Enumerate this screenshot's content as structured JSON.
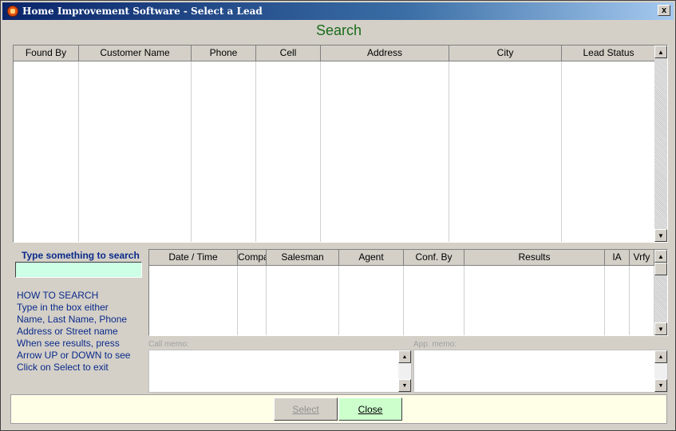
{
  "window": {
    "title": "Home Improvement Software - Select a Lead",
    "close_glyph": "x"
  },
  "heading": "Search",
  "leads_table": {
    "columns": [
      "Found By",
      "Customer Name",
      "Phone",
      "Cell",
      "Address",
      "City",
      "Lead Status"
    ],
    "rows": []
  },
  "search": {
    "label": "Type something to search",
    "value": ""
  },
  "howto": [
    "HOW TO SEARCH",
    "Type in the box either",
    "Name, Last Name, Phone",
    "Address or Street name",
    "When see results, press",
    "Arrow UP or DOWN to see",
    "Click on Select to exit"
  ],
  "appointments_table": {
    "columns": [
      "Date / Time",
      "Compa",
      "Salesman",
      "Agent",
      "Conf. By",
      "Results",
      "IA",
      "Vrfy"
    ],
    "rows": []
  },
  "memos": {
    "call_label": "Call memo:",
    "app_label": "App. memo:"
  },
  "buttons": {
    "select": "Select",
    "close": "Close"
  },
  "colors": {
    "heading": "#1a6b1a",
    "search_field": "#ccffe6",
    "close_button": "#ccffcc",
    "bottom_bar": "#ffffe8"
  }
}
